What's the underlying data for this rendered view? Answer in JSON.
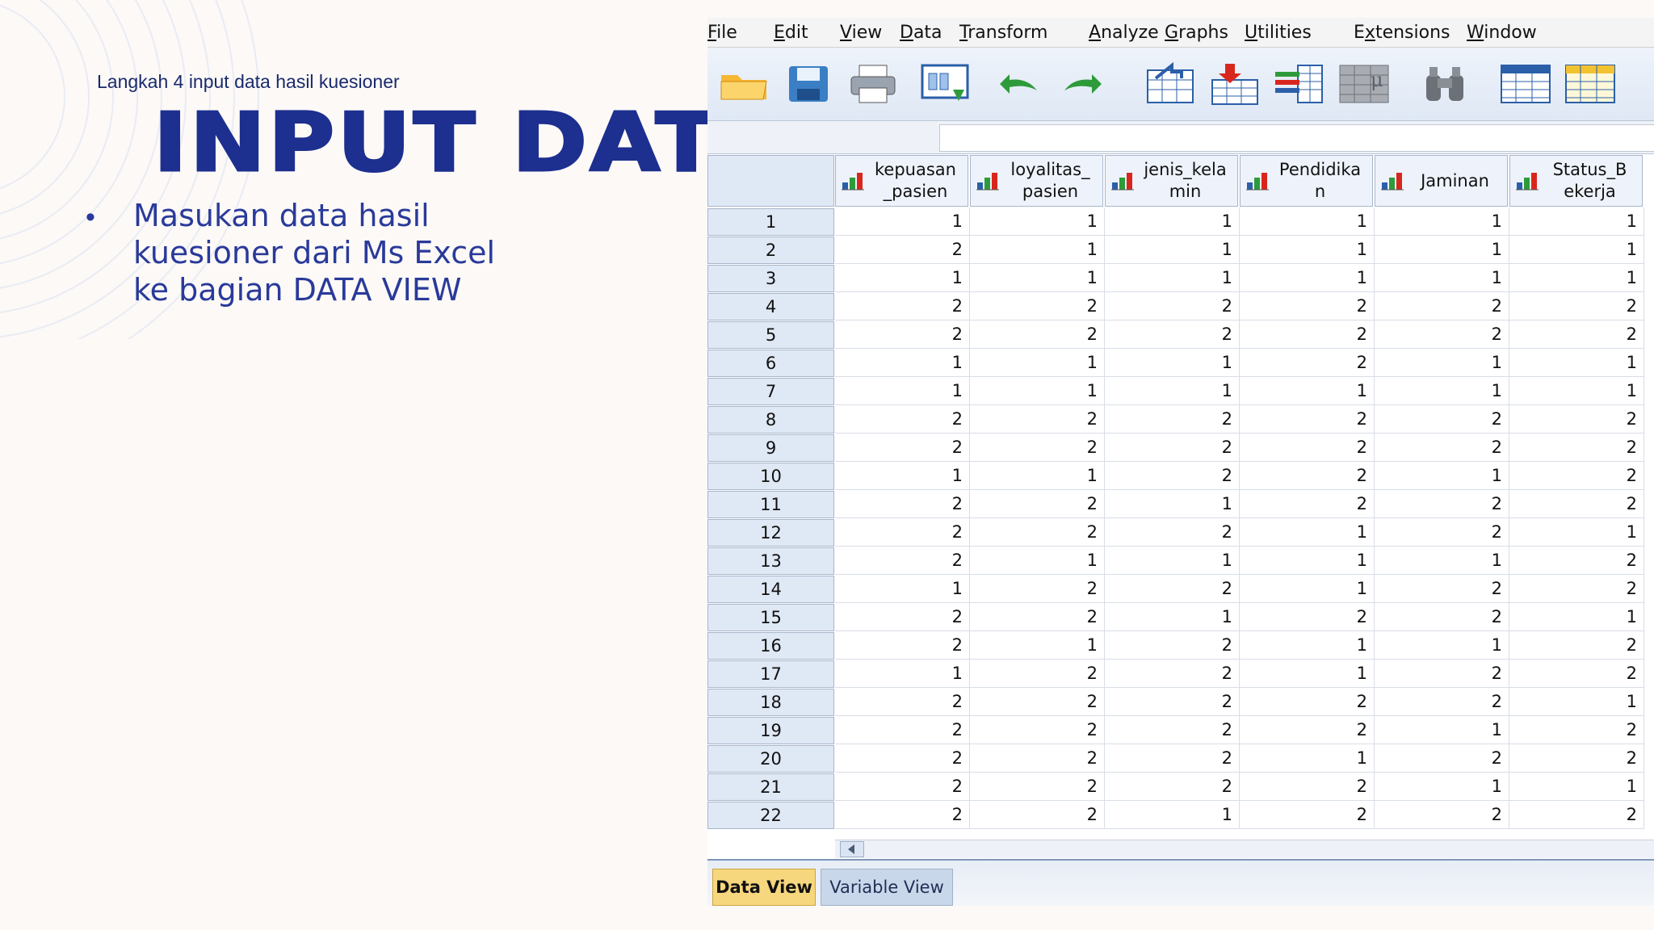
{
  "slide": {
    "subtitle": "Langkah 4 input data hasil kuesioner",
    "title": "INPUT DATA",
    "bullet": "Masukan  data hasil\nkuesioner dari Ms Excel\nke bagian DATA VIEW"
  },
  "menu": [
    {
      "label": "File",
      "accel": "F",
      "rest": "ile"
    },
    {
      "label": "Edit",
      "accel": "E",
      "rest": "dit"
    },
    {
      "label": "View",
      "accel": "V",
      "rest": "iew"
    },
    {
      "label": "Data",
      "accel": "D",
      "rest": "ata"
    },
    {
      "label": "Transform",
      "accel": "T",
      "rest": "ransform"
    },
    {
      "label": "Analyze",
      "accel": "A",
      "rest": "nalyze"
    },
    {
      "label": "Graphs",
      "accel": "G",
      "rest": "raphs"
    },
    {
      "label": "Utilities",
      "accel": "U",
      "rest": "tilities"
    },
    {
      "label": "Extensions",
      "accel": "x",
      "pre": "E",
      "rest": "tensions"
    },
    {
      "label": "Window",
      "accel": "W",
      "rest": "indow"
    }
  ],
  "toolbar": [
    "open-folder-icon",
    "save-icon",
    "print-icon",
    "dialog-recall-icon",
    "undo-icon",
    "redo-icon",
    "goto-case-icon",
    "goto-variable-icon",
    "variables-icon",
    "run-descriptives-icon",
    "find-icon",
    "insert-cases-icon",
    "insert-variable-icon"
  ],
  "columns": [
    "kepuasan\n_pasien",
    "loyalitas_\npasien",
    "jenis_kela\nmin",
    "Pendidika\nn",
    "Jaminan",
    "Status_B\nekerja"
  ],
  "rows": [
    {
      "n": "1",
      "v": [
        "1",
        "1",
        "1",
        "1",
        "1",
        "1"
      ]
    },
    {
      "n": "2",
      "v": [
        "2",
        "1",
        "1",
        "1",
        "1",
        "1"
      ]
    },
    {
      "n": "3",
      "v": [
        "1",
        "1",
        "1",
        "1",
        "1",
        "1"
      ]
    },
    {
      "n": "4",
      "v": [
        "2",
        "2",
        "2",
        "2",
        "2",
        "2"
      ]
    },
    {
      "n": "5",
      "v": [
        "2",
        "2",
        "2",
        "2",
        "2",
        "2"
      ]
    },
    {
      "n": "6",
      "v": [
        "1",
        "1",
        "1",
        "2",
        "1",
        "1"
      ]
    },
    {
      "n": "7",
      "v": [
        "1",
        "1",
        "1",
        "1",
        "1",
        "1"
      ]
    },
    {
      "n": "8",
      "v": [
        "2",
        "2",
        "2",
        "2",
        "2",
        "2"
      ]
    },
    {
      "n": "9",
      "v": [
        "2",
        "2",
        "2",
        "2",
        "2",
        "2"
      ]
    },
    {
      "n": "10",
      "v": [
        "1",
        "1",
        "2",
        "2",
        "1",
        "2"
      ]
    },
    {
      "n": "11",
      "v": [
        "2",
        "2",
        "1",
        "2",
        "2",
        "2"
      ]
    },
    {
      "n": "12",
      "v": [
        "2",
        "2",
        "2",
        "1",
        "2",
        "1"
      ]
    },
    {
      "n": "13",
      "v": [
        "2",
        "1",
        "1",
        "1",
        "1",
        "2"
      ]
    },
    {
      "n": "14",
      "v": [
        "1",
        "2",
        "2",
        "1",
        "2",
        "2"
      ]
    },
    {
      "n": "15",
      "v": [
        "2",
        "2",
        "1",
        "2",
        "2",
        "1"
      ]
    },
    {
      "n": "16",
      "v": [
        "2",
        "1",
        "2",
        "1",
        "1",
        "2"
      ]
    },
    {
      "n": "17",
      "v": [
        "1",
        "2",
        "2",
        "1",
        "2",
        "2"
      ]
    },
    {
      "n": "18",
      "v": [
        "2",
        "2",
        "2",
        "2",
        "2",
        "1"
      ]
    },
    {
      "n": "19",
      "v": [
        "2",
        "2",
        "2",
        "2",
        "1",
        "2"
      ]
    },
    {
      "n": "20",
      "v": [
        "2",
        "2",
        "2",
        "1",
        "2",
        "2"
      ]
    },
    {
      "n": "21",
      "v": [
        "2",
        "2",
        "2",
        "2",
        "1",
        "1"
      ]
    },
    {
      "n": "22",
      "v": [
        "2",
        "2",
        "1",
        "2",
        "2",
        "2"
      ]
    }
  ],
  "tabs": {
    "data_view": "Data View",
    "variable_view": "Variable View"
  }
}
